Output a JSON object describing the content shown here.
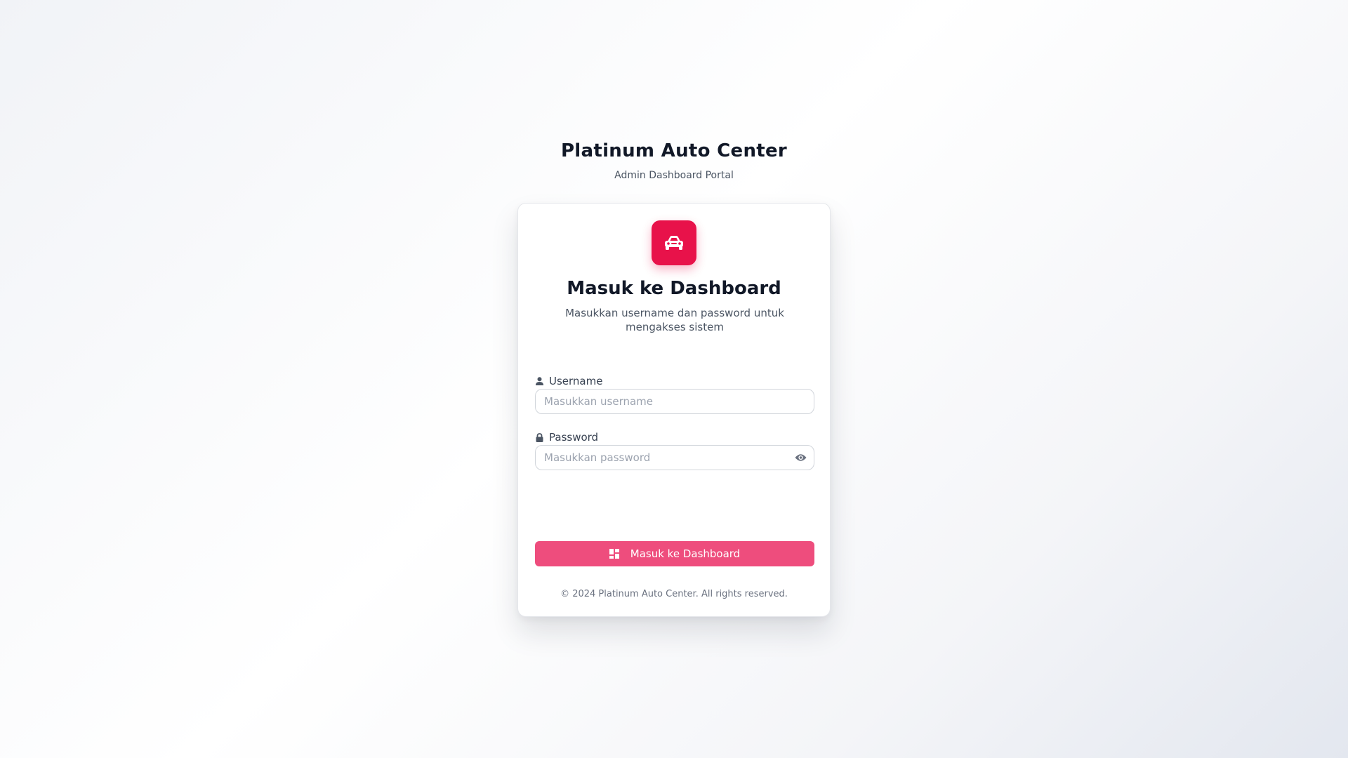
{
  "brand": {
    "title": "Platinum Auto Center",
    "subtitle": "Admin Dashboard Portal"
  },
  "card": {
    "logo_icon": "car-icon",
    "title": "Masuk ke Dashboard",
    "description": "Masukkan username dan password untuk mengakses sistem"
  },
  "form": {
    "username": {
      "label": "Username",
      "icon": "user-icon",
      "value": "",
      "placeholder": "Masukkan username"
    },
    "password": {
      "label": "Password",
      "icon": "lock-icon",
      "value": "",
      "placeholder": "Masukkan password",
      "toggle_icon": "eye-icon"
    },
    "submit": {
      "label": "Masuk ke Dashboard",
      "icon": "dashboard-icon"
    }
  },
  "footer": {
    "copyright": "© 2024 Platinum Auto Center. All rights reserved."
  },
  "colors": {
    "accent": "#e8124a",
    "button": "#ee4d7d",
    "heading": "#111827"
  }
}
